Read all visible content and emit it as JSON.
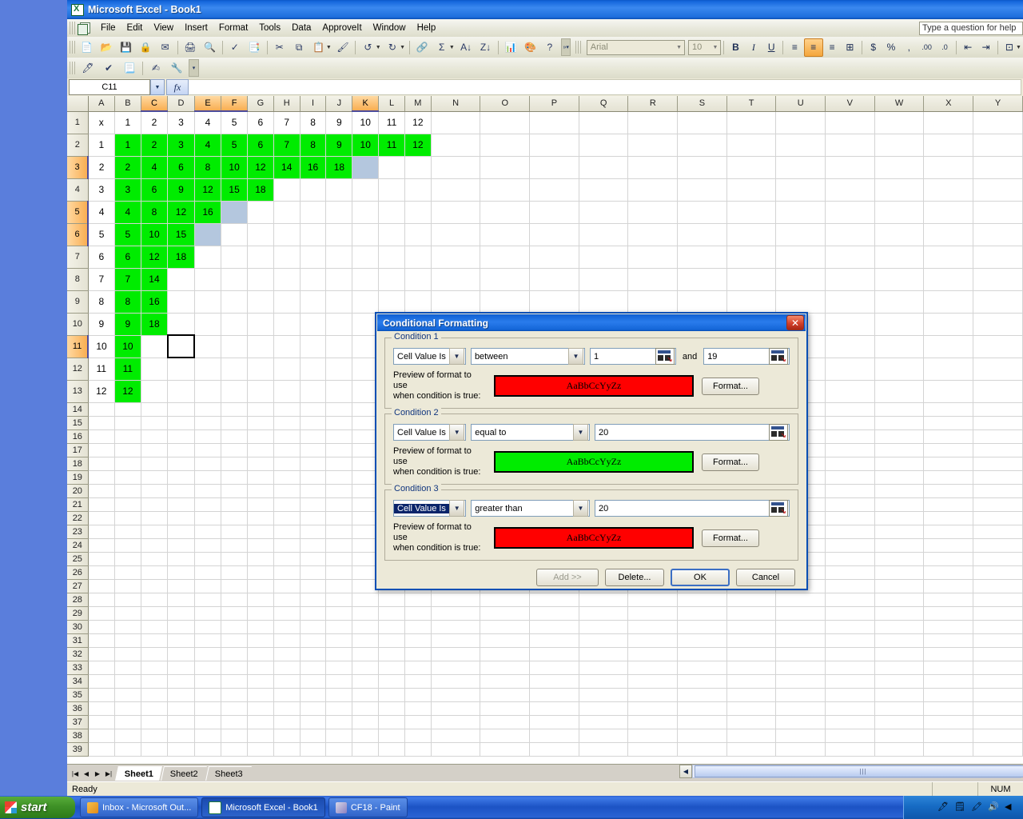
{
  "window": {
    "title": "Microsoft Excel - Book1",
    "app_icon": "excel-icon"
  },
  "menubar": {
    "items": [
      "File",
      "Edit",
      "View",
      "Insert",
      "Format",
      "Tools",
      "Data",
      "ApproveIt",
      "Window",
      "Help"
    ],
    "ask_box_placeholder": "Type a question for help"
  },
  "toolbars": {
    "standard_icons": [
      "new-icon",
      "open-icon",
      "save-icon",
      "permission-icon",
      "email-icon",
      "print-icon",
      "print-preview-icon",
      "spelling-icon",
      "research-icon",
      "cut-icon",
      "copy-icon",
      "paste-icon",
      "format-painter-icon",
      "undo-icon",
      "redo-icon",
      "hyperlink-icon",
      "autosum-icon",
      "sort-ascending-icon",
      "sort-descending-icon",
      "chart-wizard-icon",
      "drawing-icon",
      "help-icon"
    ],
    "approveit_icons": [
      "sign-icon",
      "approve-icon",
      "document-icon",
      "signature-icon",
      "settings-icon"
    ],
    "formatting": {
      "font_name": "Arial",
      "font_size": "10",
      "bold_label": "B",
      "italic_label": "I",
      "underline_label": "U",
      "align_left": "align-left-icon",
      "align_center": "align-center-icon",
      "align_right": "align-right-icon",
      "merge_center": "merge-center-icon",
      "currency_label": "$",
      "percent_label": "%",
      "comma_label": ",",
      "increase_decimal": "increase-decimal-icon",
      "decrease_decimal": "decrease-decimal-icon",
      "decrease_indent": "decrease-indent-icon",
      "increase_indent": "increase-indent-icon",
      "borders": "borders-icon"
    }
  },
  "formula_bar": {
    "name_box": "C11",
    "fx_label": "fx",
    "formula": ""
  },
  "grid": {
    "columns": [
      "A",
      "B",
      "C",
      "D",
      "E",
      "F",
      "G",
      "H",
      "I",
      "J",
      "K",
      "L",
      "M",
      "N",
      "O",
      "P",
      "Q",
      "R",
      "S",
      "T",
      "U",
      "V",
      "W",
      "X",
      "Y"
    ],
    "selected_columns": [
      "C",
      "E",
      "F",
      "K"
    ],
    "selected_rows": [
      3,
      5,
      6,
      11
    ],
    "row_count": 39,
    "rows": [
      {
        "n": 1,
        "cells": [
          "x",
          "1",
          "2",
          "3",
          "4",
          "5",
          "6",
          "7",
          "8",
          "9",
          "10",
          "11",
          "12"
        ]
      },
      {
        "n": 2,
        "cells": [
          "1",
          "1",
          "2",
          "3",
          "4",
          "5",
          "6",
          "7",
          "8",
          "9",
          "10",
          "11",
          "12"
        ]
      },
      {
        "n": 3,
        "cells": [
          "2",
          "2",
          "4",
          "6",
          "8",
          "10",
          "12",
          "14",
          "16",
          "18",
          "",
          ""
        ]
      },
      {
        "n": 4,
        "cells": [
          "3",
          "3",
          "6",
          "9",
          "12",
          "15",
          "18",
          "",
          "",
          "",
          "",
          ""
        ]
      },
      {
        "n": 5,
        "cells": [
          "4",
          "4",
          "8",
          "12",
          "16",
          "",
          "",
          "",
          "",
          "",
          "",
          ""
        ]
      },
      {
        "n": 6,
        "cells": [
          "5",
          "5",
          "10",
          "15",
          "",
          "",
          "",
          "",
          "",
          "",
          "",
          ""
        ]
      },
      {
        "n": 7,
        "cells": [
          "6",
          "6",
          "12",
          "18",
          "",
          "",
          "",
          "",
          "",
          "",
          "",
          ""
        ]
      },
      {
        "n": 8,
        "cells": [
          "7",
          "7",
          "14",
          "",
          "",
          "",
          "",
          "",
          "",
          "",
          "",
          ""
        ]
      },
      {
        "n": 9,
        "cells": [
          "8",
          "8",
          "16",
          "",
          "",
          "",
          "",
          "",
          "",
          "",
          "",
          ""
        ]
      },
      {
        "n": 10,
        "cells": [
          "9",
          "9",
          "18",
          "",
          "",
          "",
          "",
          "",
          "",
          "",
          "",
          ""
        ]
      },
      {
        "n": 11,
        "cells": [
          "10",
          "10",
          "",
          "",
          "",
          "",
          "",
          "",
          "",
          "",
          "",
          ""
        ]
      },
      {
        "n": 12,
        "cells": [
          "11",
          "11",
          "",
          "",
          "",
          "",
          "",
          "",
          "",
          "",
          "",
          ""
        ]
      },
      {
        "n": 13,
        "cells": [
          "12",
          "12",
          "",
          "",
          "",
          "",
          "",
          "",
          "",
          "",
          "",
          ""
        ]
      }
    ],
    "green_cells": [
      "B2",
      "C2",
      "D2",
      "E2",
      "F2",
      "G2",
      "H2",
      "I2",
      "J2",
      "K2",
      "L2",
      "M2",
      "B3",
      "C3",
      "D3",
      "E3",
      "F3",
      "G3",
      "H3",
      "I3",
      "J3",
      "B4",
      "C4",
      "D4",
      "E4",
      "F4",
      "G4",
      "B5",
      "C5",
      "D5",
      "E5",
      "B6",
      "C6",
      "D6",
      "B7",
      "C7",
      "D7",
      "B8",
      "C8",
      "B9",
      "C9",
      "B10",
      "C10",
      "B11",
      "B12",
      "B13"
    ],
    "blue_selected_cells": [
      "K3",
      "F5",
      "E6"
    ],
    "active_cell": "D11",
    "colors": {
      "green_fill": "#00ec00",
      "selection_blue": "#b4c7de",
      "header_selected": "#f9ae52"
    }
  },
  "sheet_tabs": {
    "tabs": [
      "Sheet1",
      "Sheet2",
      "Sheet3"
    ],
    "active": "Sheet1",
    "nav_first": "first-sheet-icon",
    "nav_prev": "previous-sheet-icon",
    "nav_next": "next-sheet-icon",
    "nav_last": "last-sheet-icon"
  },
  "status_bar": {
    "message": "Ready",
    "indicators": [
      "",
      "NUM"
    ]
  },
  "dialog": {
    "title": "Conditional Formatting",
    "close_label": "✕",
    "preview_text": "AaBbCcYyZz",
    "preview_label_line1": "Preview of format to use",
    "preview_label_line2": "when condition is true:",
    "format_button": "Format...",
    "and_label": "and",
    "conditions": [
      {
        "legend": "Condition 1",
        "type": "Cell Value Is",
        "type_highlighted": false,
        "operator": "between",
        "value1": "1",
        "value2": "19",
        "two_values": true,
        "preview_bg": "#ff0000",
        "preview_fg": "#000000"
      },
      {
        "legend": "Condition 2",
        "type": "Cell Value Is",
        "type_highlighted": false,
        "operator": "equal to",
        "value1": "20",
        "value2": "",
        "two_values": false,
        "preview_bg": "#00ec00",
        "preview_fg": "#000000"
      },
      {
        "legend": "Condition 3",
        "type": "Cell Value Is",
        "type_highlighted": true,
        "operator": "greater than",
        "value1": "20",
        "value2": "",
        "two_values": false,
        "preview_bg": "#ff0000",
        "preview_fg": "#000000"
      }
    ],
    "buttons": {
      "add": "Add >>",
      "add_disabled": true,
      "delete": "Delete...",
      "ok": "OK",
      "cancel": "Cancel"
    }
  },
  "taskbar": {
    "start_label": "start",
    "items": [
      {
        "label": "Inbox - Microsoft Out...",
        "icon": "outlook-icon",
        "active": false
      },
      {
        "label": "Microsoft Excel - Book1",
        "icon": "excel-icon",
        "active": true
      },
      {
        "label": "CF18 - Paint",
        "icon": "paint-icon",
        "active": false
      }
    ],
    "tray_icons": [
      "pen-icon",
      "note-icon",
      "highlighter-icon",
      "volume-icon",
      "show-hidden-icon"
    ]
  }
}
